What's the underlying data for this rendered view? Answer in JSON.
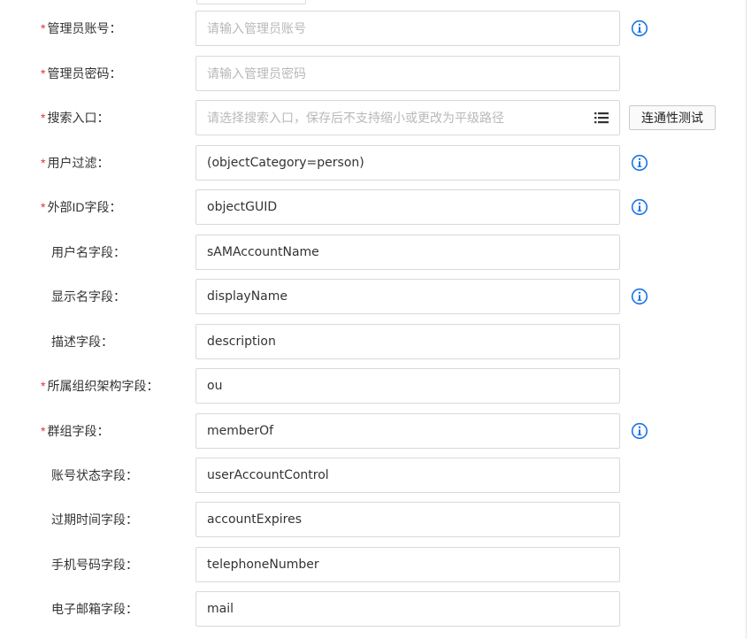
{
  "form": {
    "fields": [
      {
        "label": "管理员账号：",
        "required": true,
        "value": "",
        "placeholder": "请输入管理员账号",
        "info": true
      },
      {
        "label": "管理员密码：",
        "required": true,
        "value": "",
        "placeholder": "请输入管理员密码",
        "info": false
      },
      {
        "label": "搜索入口：",
        "required": true,
        "value": "",
        "placeholder": "请选择搜索入口，保存后不支持缩小或更改为平级路径",
        "info": false,
        "list_icon": true,
        "button": "连通性测试"
      },
      {
        "label": "用户过滤：",
        "required": true,
        "value": "(objectCategory=person)",
        "placeholder": "",
        "info": true
      },
      {
        "label": "外部ID字段：",
        "required": true,
        "value": "objectGUID",
        "placeholder": "",
        "info": true
      },
      {
        "label": "用户名字段：",
        "required": false,
        "value": "sAMAccountName",
        "placeholder": "",
        "info": false
      },
      {
        "label": "显示名字段：",
        "required": false,
        "value": "displayName",
        "placeholder": "",
        "info": true
      },
      {
        "label": "描述字段：",
        "required": false,
        "value": "description",
        "placeholder": "",
        "info": false
      },
      {
        "label": "所属组织架构字段：",
        "required": true,
        "value": "ou",
        "placeholder": "",
        "info": false
      },
      {
        "label": "群组字段：",
        "required": true,
        "value": "memberOf",
        "placeholder": "",
        "info": true
      },
      {
        "label": "账号状态字段：",
        "required": false,
        "value": "userAccountControl",
        "placeholder": "",
        "info": false
      },
      {
        "label": "过期时间字段：",
        "required": false,
        "value": "accountExpires",
        "placeholder": "",
        "info": false
      },
      {
        "label": "手机号码字段：",
        "required": false,
        "value": "telephoneNumber",
        "placeholder": "",
        "info": false
      },
      {
        "label": "电子邮箱字段：",
        "required": false,
        "value": "mail",
        "placeholder": "",
        "info": false
      }
    ]
  },
  "colors": {
    "required_mark": "#e0353a",
    "info_icon": "#1a73e8",
    "border": "#d9d9d9",
    "placeholder": "#b8b8b8"
  },
  "icons": {
    "info": "info-circle-icon",
    "list": "list-icon"
  }
}
